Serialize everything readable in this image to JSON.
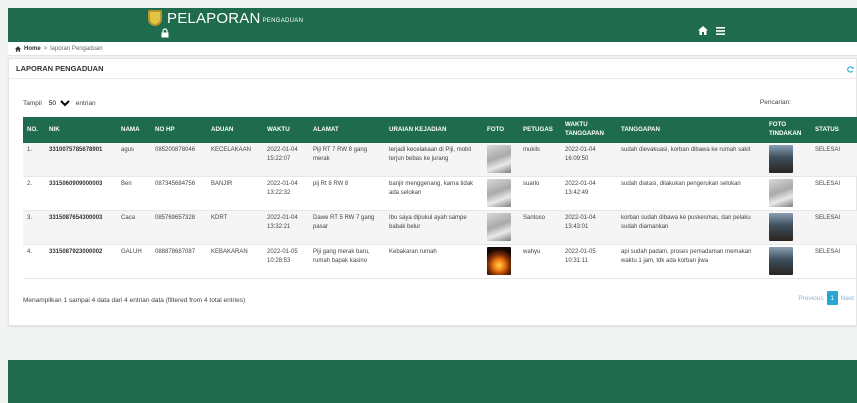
{
  "header": {
    "title": "PELAPORAN",
    "subtitle": "PENGADUAN",
    "icons": [
      "lock-icon",
      "home-icon",
      "menu-icon"
    ]
  },
  "breadcrumb": {
    "home": "Home",
    "separator": ">",
    "current": "laporan Pengaduan"
  },
  "card": {
    "title": "LAPORAN PENGADUAN"
  },
  "controls": {
    "show_prefix": "Tampil",
    "page_size": "50",
    "show_suffix": "entrian",
    "search_label": "Pencarian:"
  },
  "table": {
    "columns": [
      "NO.",
      "NIK",
      "NAMA",
      "NO HP",
      "ADUAN",
      "WAKTU",
      "ALAMAT",
      "URAIAN KEJADIAN",
      "FOTO",
      "PETUGAS",
      "WAKTU TANGGAPAN",
      "TANGGAPAN",
      "FOTO TINDAKAN",
      "STATUS"
    ],
    "rows": [
      {
        "no": "1.",
        "nik": "3310075785678901",
        "nama": "agus",
        "hp": "085200878046",
        "aduan": "KECELAKAAN",
        "waktu": "2022-01-04 15:22:07",
        "alamat": "Piji RT 7 RW 8 gang merak",
        "uraian": "terjadi kecelakaan di Piji, mobil terjun bebas ke jurang",
        "petugas": "mukils",
        "waktu_tanggapan": "2022-01-04 16:09:50",
        "tanggapan": "sudah dievakuasi, korban dibawa ke rumah sakit",
        "status": "SELESAI",
        "foto": "ph-girl",
        "foto_tindakan": "ph-people"
      },
      {
        "no": "2.",
        "nik": "3315060909000003",
        "nama": "Ben",
        "hp": "087345684756",
        "aduan": "BANJIR",
        "waktu": "2022-01-04 13:22:32",
        "alamat": "pij Rt 8 RW 8",
        "uraian": "banjir menggenang, karna tidak ada selokan",
        "petugas": "suarlo",
        "waktu_tanggapan": "2022-01-04 13:42:49",
        "tanggapan": "sudah diatasi, dilakukan pengerukan selokan",
        "status": "SELESAI",
        "foto": "ph-girl",
        "foto_tindakan": "ph-girl"
      },
      {
        "no": "3.",
        "nik": "3315087654300003",
        "nama": "Caca",
        "hp": "085769657328",
        "aduan": "KDRT",
        "waktu": "2022-01-04 13:32:21",
        "alamat": "Dawe RT 5 RW 7 gang pasar",
        "uraian": "Ibu saya dipukul ayah sampe babak belur",
        "petugas": "Santoso",
        "waktu_tanggapan": "2022-01-04 13:43:01",
        "tanggapan": "korban sudah dibawa ke puskesmas, dan pelaku sudah diamankan",
        "status": "SELESAI",
        "foto": "ph-girl",
        "foto_tindakan": "ph-people"
      },
      {
        "no": "4.",
        "nik": "3315087923000002",
        "nama": "GALUH",
        "hp": "088878687087",
        "aduan": "KEBAKARAN",
        "waktu": "2022-01-05 10:28:53",
        "alamat": "Piji gang merak baru, rumah bapak kasino",
        "uraian": "Kebakaran rumah",
        "petugas": "wahyu",
        "waktu_tanggapan": "2022-01-05 10:31:11",
        "tanggapan": "api sudah padam, proses pemadaman memakan waktu 1 jam, tdk ada korban jiwa",
        "status": "SELESAI",
        "foto": "ph-fire",
        "foto_tindakan": "ph-people"
      }
    ]
  },
  "footer": {
    "info": "Menampilkan 1 sampai 4 data dari 4 entrian data (filtered from 4 total entries)",
    "previous": "Previous",
    "page": "1",
    "next": "Next"
  }
}
